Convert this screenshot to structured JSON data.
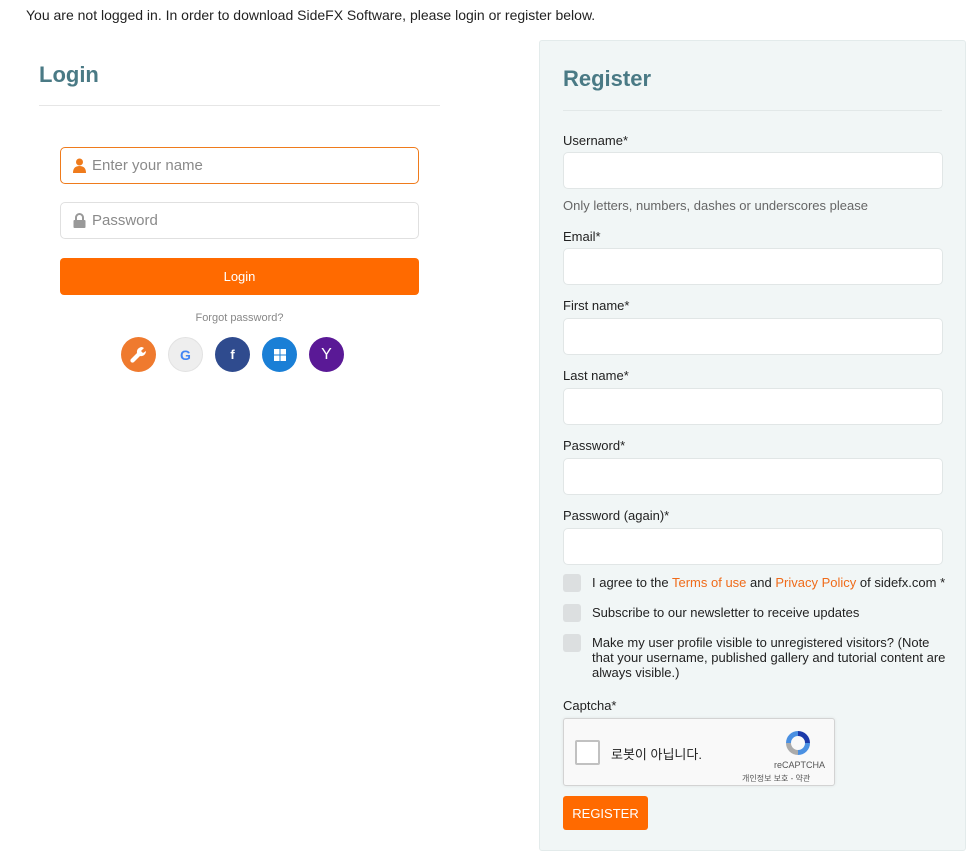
{
  "notice": "You are not logged in. In order to download SideFX Software, please login or register below.",
  "login": {
    "title": "Login",
    "name_placeholder": "Enter your name",
    "password_placeholder": "Password",
    "button": "Login",
    "forgot": "Forgot password?",
    "social": [
      {
        "name": "sidefx",
        "letter": "",
        "color": "#ef7a2e"
      },
      {
        "name": "google",
        "letter": "G",
        "color": "#eeeeee"
      },
      {
        "name": "facebook",
        "letter": "f",
        "color": "#2f4b8e"
      },
      {
        "name": "windows",
        "letter": "",
        "color": "#1a7fd6"
      },
      {
        "name": "yahoo",
        "letter": "Y",
        "color": "#5a1996"
      }
    ]
  },
  "register": {
    "title": "Register",
    "username_label": "Username*",
    "username_help": "Only letters, numbers, dashes or underscores please",
    "email_label": "Email*",
    "firstname_label": "First name*",
    "lastname_label": "Last name*",
    "password_label": "Password*",
    "password_again_label": "Password (again)*",
    "agree_prefix": "I agree to the ",
    "terms_link": "Terms of use",
    "agree_and": " and ",
    "privacy_link": "Privacy Policy",
    "agree_suffix": " of sidefx.com *",
    "newsletter": "Subscribe to our newsletter to receive updates",
    "profile_visible": "Make my user profile visible to unregistered visitors? (Note that your username, published gallery and tutorial content are always visible.)",
    "captcha_label": "Captcha*",
    "captcha_text": "로봇이 아닙니다.",
    "captcha_brand": "reCAPTCHA",
    "captcha_terms": "개인정보 보호 - 약관",
    "button": "REGISTER"
  },
  "colors": {
    "accent": "#ff6a00",
    "heading": "#4a7a85",
    "link": "#ef6b1a"
  }
}
